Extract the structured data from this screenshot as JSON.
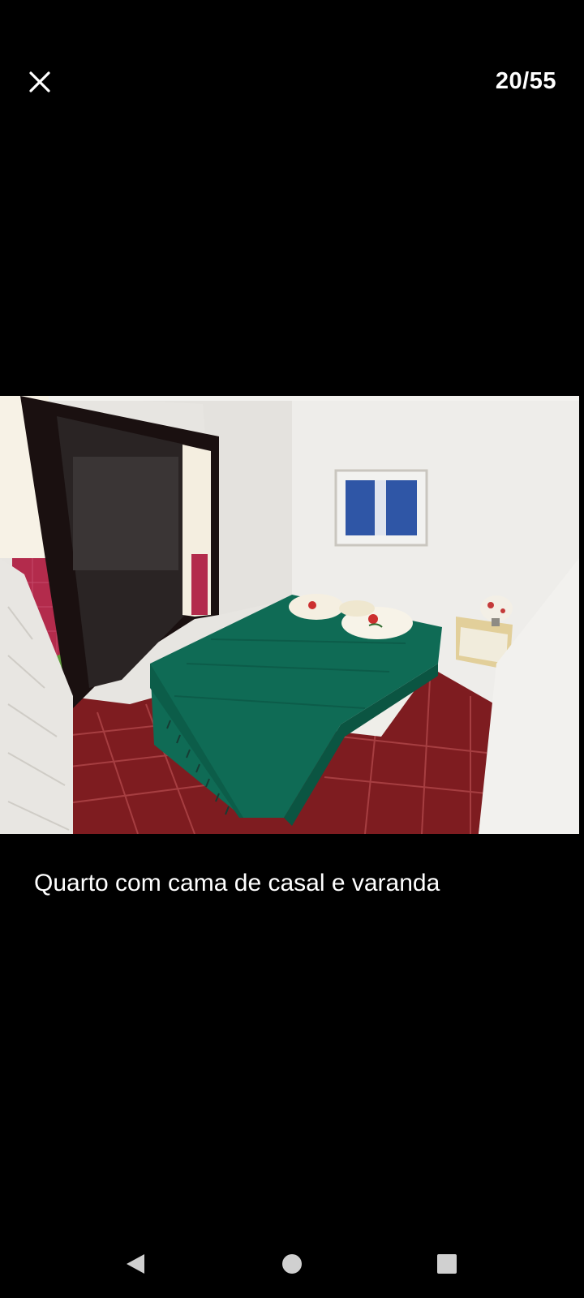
{
  "viewer": {
    "counter": "20/55",
    "caption": "Quarto com cama de casal e varanda"
  },
  "icons": {
    "close": "close-icon",
    "back": "back-triangle-icon",
    "home": "home-circle-icon",
    "recents": "recents-square-icon"
  },
  "colors": {
    "background": "#000000",
    "text": "#ffffff",
    "bedspread": "#0f6b55",
    "floor_tile": "#8a1e22",
    "balcony_tile": "#b02a4a"
  }
}
